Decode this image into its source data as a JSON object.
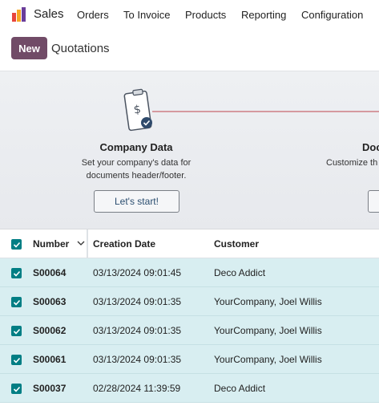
{
  "app": {
    "name": "Sales"
  },
  "nav": [
    {
      "label": "Orders"
    },
    {
      "label": "To Invoice"
    },
    {
      "label": "Products"
    },
    {
      "label": "Reporting"
    },
    {
      "label": "Configuration"
    }
  ],
  "control_panel": {
    "new_label": "New",
    "title": "Quotations"
  },
  "onboarding": {
    "step1": {
      "title": "Company Data",
      "desc_line1": "Set your company's data for",
      "desc_line2": "documents header/footer.",
      "button": "Let's start!"
    },
    "step2": {
      "title": "Doc",
      "desc": "Customize th"
    }
  },
  "table": {
    "headers": {
      "number": "Number",
      "creation_date": "Creation Date",
      "customer": "Customer"
    },
    "rows": [
      {
        "number": "S00064",
        "date": "03/13/2024 09:01:45",
        "customer": "Deco Addict",
        "checked": true
      },
      {
        "number": "S00063",
        "date": "03/13/2024 09:01:35",
        "customer": "YourCompany, Joel Willis",
        "checked": true
      },
      {
        "number": "S00062",
        "date": "03/13/2024 09:01:35",
        "customer": "YourCompany, Joel Willis",
        "checked": true
      },
      {
        "number": "S00061",
        "date": "03/13/2024 09:01:35",
        "customer": "YourCompany, Joel Willis",
        "checked": true
      },
      {
        "number": "S00037",
        "date": "02/28/2024 11:39:59",
        "customer": "Deco Addict",
        "checked": true
      }
    ]
  },
  "colors": {
    "brand": "#714b67",
    "checkbox": "#017e84",
    "selected_row": "#d8eef1",
    "progress_line": "#d59a9f"
  }
}
